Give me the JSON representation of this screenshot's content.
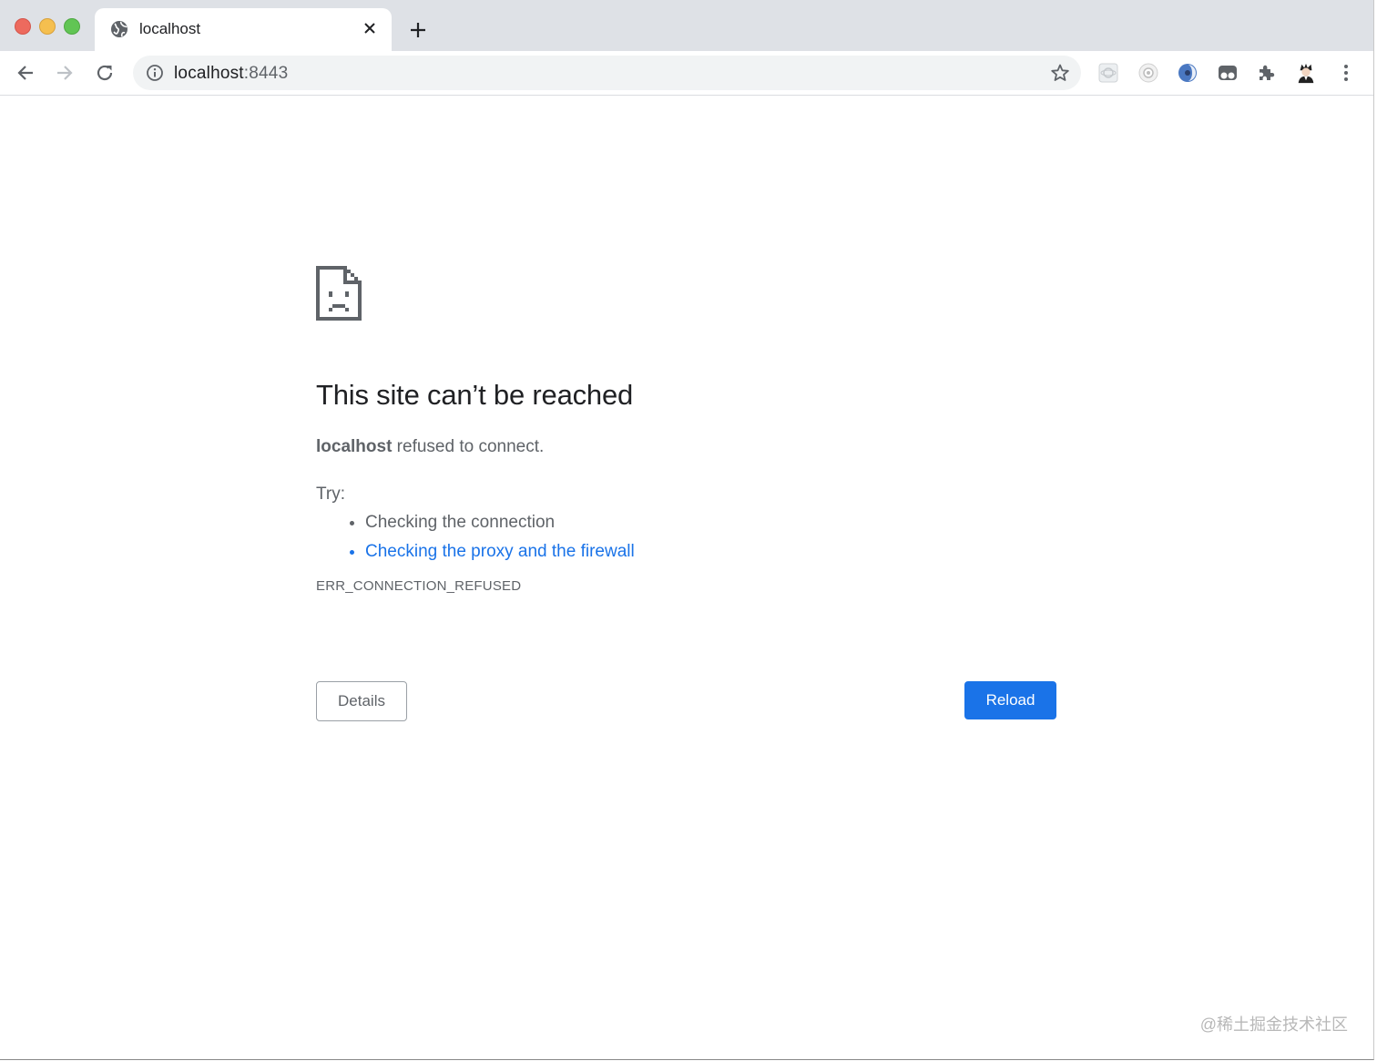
{
  "tab": {
    "title": "localhost"
  },
  "omnibox": {
    "host": "localhost",
    "port": ":8443"
  },
  "error_page": {
    "heading": "This site can’t be reached",
    "host_bold": "localhost",
    "subtitle_rest": " refused to connect.",
    "try_label": "Try:",
    "suggestions": [
      "Checking the connection",
      "Checking the proxy and the firewall"
    ],
    "error_code": "ERR_CONNECTION_REFUSED",
    "details_label": "Details",
    "reload_label": "Reload"
  },
  "watermark": "@稀土掘金技术社区",
  "colors": {
    "accent": "#1a73e8",
    "text_primary": "#202124",
    "text_secondary": "#5f6368",
    "tabstrip": "#dee1e6"
  },
  "icons": {
    "tab_favicon": "globe-icon",
    "tab_close": "close-icon",
    "new_tab": "plus-icon",
    "back": "arrow-left-icon",
    "forward": "arrow-right-icon",
    "reload": "reload-icon",
    "site_info": "info-icon",
    "bookmark": "star-icon",
    "extensions": "puzzle-icon",
    "menu": "kebab-menu-icon",
    "error": "sad-document-icon"
  }
}
